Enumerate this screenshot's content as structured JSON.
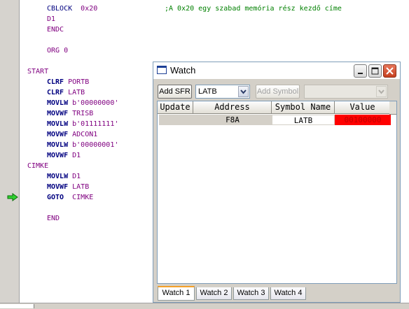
{
  "code": {
    "lines": [
      {
        "t": "cblock",
        "op": "CBLOCK",
        "arg": "0x20",
        "comment": ";A 0x20 egy szabad memória rész kezdő címe"
      },
      {
        "t": "plain",
        "text": "D1"
      },
      {
        "t": "plain",
        "text": "ENDC"
      },
      {
        "t": "plain",
        "text": "ORG 0"
      },
      {
        "t": "label",
        "text": "START"
      },
      {
        "t": "instr",
        "op": "CLRF",
        "arg": "PORTB"
      },
      {
        "t": "instr",
        "op": "CLRF",
        "arg": "LATB"
      },
      {
        "t": "instr",
        "op": "MOVLW",
        "arg": "b'00000000'"
      },
      {
        "t": "instr",
        "op": "MOVWF",
        "arg": "TRISB"
      },
      {
        "t": "instr",
        "op": "MOVLW",
        "arg": "b'01111111'"
      },
      {
        "t": "instr",
        "op": "MOVWF",
        "arg": "ADCON1"
      },
      {
        "t": "instr",
        "op": "MOVLW",
        "arg": "b'00000001'"
      },
      {
        "t": "instr",
        "op": "MOVWF",
        "arg": "D1"
      },
      {
        "t": "label",
        "text": "CIMKE"
      },
      {
        "t": "instr",
        "op": "MOVLW",
        "arg": "D1"
      },
      {
        "t": "instr",
        "op": "MOVWF",
        "arg": "LATB"
      },
      {
        "t": "instr",
        "op": "GOTO",
        "arg": "CIMKE"
      },
      {
        "t": "plain",
        "text": "END"
      }
    ],
    "current_line_icon": "green-arrow-icon"
  },
  "watch": {
    "title": "Watch",
    "add_sfr_label": "Add SFR",
    "sfr_select_value": "LATB",
    "add_symbol_label": "Add Symbol",
    "symbol_select_value": "",
    "columns": [
      "Update",
      "Address",
      "Symbol Name",
      "Value"
    ],
    "rows": [
      {
        "update": "",
        "address": "F8A",
        "symbol": "LATB",
        "value": "00100000"
      }
    ],
    "tabs": [
      "Watch 1",
      "Watch 2",
      "Watch 3",
      "Watch 4"
    ],
    "active_tab": "Watch 1"
  },
  "colors": {
    "changed_value_bg": "#ff0000",
    "changed_value_text": "#c00000",
    "comment": "#008000",
    "keyword": "#000080"
  }
}
